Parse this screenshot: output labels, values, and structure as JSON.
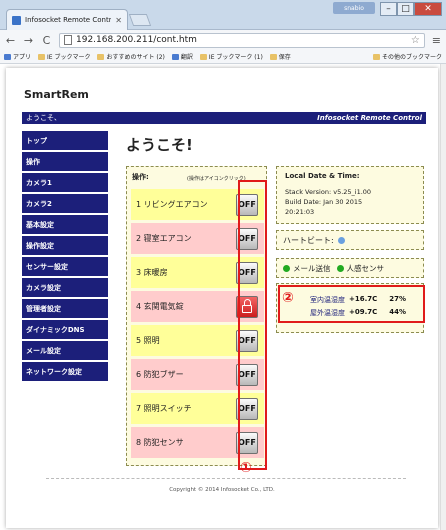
{
  "browser": {
    "tab_title": "Infosocket Remote Control",
    "user_badge": "snabio",
    "url": "192.168.200.211/cont.htm",
    "back": "←",
    "forward": "→",
    "reload": "C",
    "menu": "≡",
    "bookmarks": [
      "アプリ",
      "IE ブックマーク",
      "おすすめのサイト (2)",
      "翻訳",
      "IE ブックマーク (1)",
      "保存",
      "その他のブックマーク"
    ]
  },
  "page": {
    "logo": "SmartRem",
    "welcome_bar": "ようこそ、",
    "brand_bar": "Infosocket Remote Control",
    "heading": "ようこそ!",
    "sidebar": [
      "トップ",
      "操作",
      "カメラ1",
      "カメラ2",
      "基本設定",
      "操作設定",
      "センサー設定",
      "カメラ設定",
      "管理者設定",
      "ダイナミックDNS",
      "メール設定",
      "ネットワーク設定"
    ],
    "ops": {
      "header": "操作:",
      "note": "(操作はアイコンクリック)",
      "rows": [
        {
          "label": "1 リビングエアコン",
          "state": "OFF",
          "bg": "y"
        },
        {
          "label": "2 寝室エアコン",
          "state": "OFF",
          "bg": "p"
        },
        {
          "label": "3 床暖房",
          "state": "OFF",
          "bg": "y"
        },
        {
          "label": "4 玄関電気錠",
          "state": "",
          "bg": "p",
          "icon": "padlock-icon"
        },
        {
          "label": "5 照明",
          "state": "OFF",
          "bg": "y"
        },
        {
          "label": "6 防犯ブザー",
          "state": "OFF",
          "bg": "p"
        },
        {
          "label": "7 照明スイッチ",
          "state": "OFF",
          "bg": "y"
        },
        {
          "label": "8 防犯センサ",
          "state": "OFF",
          "bg": "p"
        }
      ]
    },
    "status": {
      "date_title": "Local Date & Time:",
      "stack_version": "Stack Version: v5.25_i1.00",
      "build_date": "Build Date: Jan 30 2015",
      "time": "20:21:03",
      "heartbeat": "ハートビート:",
      "mail_send": "メール送信",
      "motion_sensor": "人感センサ"
    },
    "climate": {
      "indoor_label": "室内温湿度",
      "indoor_temp": "+16.7C",
      "indoor_humidity": "27%",
      "outdoor_label": "屋外温湿度",
      "outdoor_temp": "+09.7C",
      "outdoor_humidity": "44%"
    },
    "annotations": {
      "one": "①",
      "two": "②"
    },
    "copyright": "Copyright © 2014 Infosocket Co., LTD."
  },
  "colors": {
    "nav_blue": "#1c1f7a",
    "highlight_red": "#e01b1b",
    "row_yellow": "#ffff99",
    "row_pink": "#ffcccc",
    "green_dot": "#22aa22",
    "heartbeat_dot": "#6aa0e0"
  }
}
